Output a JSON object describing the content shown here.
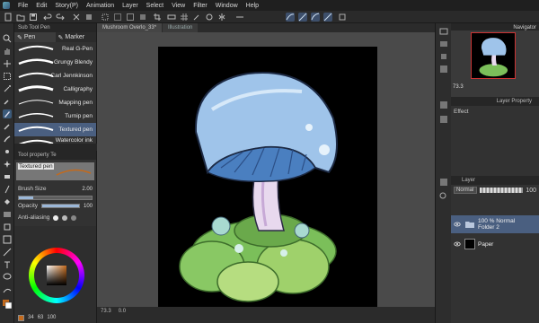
{
  "menu": [
    "File",
    "Edit",
    "Story(P)",
    "Animation",
    "Layer",
    "Select",
    "View",
    "Filter",
    "Window",
    "Help"
  ],
  "subtool": {
    "header": "Sub Tool Pen",
    "tabs": [
      "Pen",
      "Marker"
    ],
    "brushes": [
      "Real G-Pen",
      "Grungy Blendy",
      "Carl Jennkinson",
      "Calligraphy",
      "Mapping pen",
      "Turnip pen",
      "Textured pen",
      "Watercolor ink"
    ],
    "selected_index": 6
  },
  "tool_property": {
    "header": "Tool property Te",
    "preview_label": "Textured pen",
    "brush_size_label": "Brush Size",
    "brush_size_value": "2.00",
    "opacity_label": "Opacity",
    "opacity_value": "100",
    "opacity_fraction": 1.0,
    "brush_size_fraction": 0.2,
    "antialias_label": "Anti-aliasing"
  },
  "color": {
    "main": "#c46a1c",
    "foot_values": [
      "34",
      "63",
      "100"
    ]
  },
  "canvas": {
    "tabs": [
      "Mushroom Overlo_33*",
      "Illustration"
    ],
    "zoom_status": "73.3",
    "status_angle": "0.0"
  },
  "navigator": {
    "title": "Navigator",
    "zoom": "73.3"
  },
  "layer_property": {
    "title": "Layer Property",
    "effect_label": "Effect"
  },
  "layers": {
    "title": "Layer",
    "blend_mode": "Normal",
    "opacity_value": "100",
    "items": [
      {
        "line1": "100 % Normal",
        "line2": "Folder 2",
        "selected": true
      },
      {
        "line1": "",
        "line2": "Paper",
        "selected": false
      }
    ]
  },
  "colors": {
    "accent": "#4a5f80",
    "background": "#2b2b2b",
    "panel": "#323232"
  }
}
